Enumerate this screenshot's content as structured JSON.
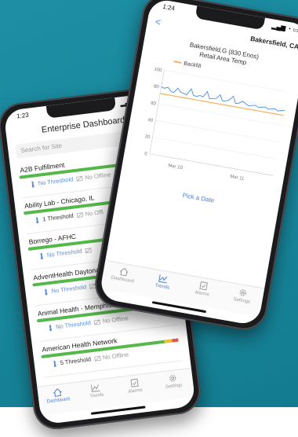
{
  "left_phone": {
    "time": "1:23",
    "title": "Enterprise Dashboard",
    "search_placeholder": "Search for Site",
    "sites": [
      {
        "name": "A2B Fulfillment",
        "threshold": "No Threshold",
        "offline": "No Offline",
        "bar": "green"
      },
      {
        "name": "Ability Lab - Chicago, IL",
        "threshold": "1 Threshold",
        "offline": "No Offl",
        "bar": "green-yellow"
      },
      {
        "name": "Borrego - AFHC",
        "threshold": "No Threshold",
        "offline": "",
        "bar": "green"
      },
      {
        "name": "AdventHealth Daytona",
        "threshold": "No Threshold",
        "offline": "",
        "bar": "green"
      },
      {
        "name": "Animal Health - Memphis",
        "threshold": "No Threshold",
        "offline": "No Offline",
        "bar": "green"
      },
      {
        "name": "American Health Network",
        "threshold": "5 Threshold",
        "offline": "No Offline",
        "bar": "green-yellow-red"
      }
    ],
    "tabs": [
      {
        "label": "Dashboard",
        "icon": "home-icon",
        "active": true
      },
      {
        "label": "Trends",
        "icon": "trend-icon",
        "active": false
      },
      {
        "label": "Alarms",
        "icon": "alarm-icon",
        "active": false
      },
      {
        "label": "Settings",
        "icon": "gear-icon",
        "active": false
      }
    ]
  },
  "right_phone": {
    "time": "1:24",
    "nav_back": "<",
    "nav_title": "Bakersfield, CA",
    "chart_title_line1": "Bakersfield,G (830 Enos)",
    "chart_title_line2": "Retail Area Temp",
    "legend_label": "Backfill",
    "pick_date": "Pick a Date",
    "tabs": [
      {
        "label": "Dashboard",
        "icon": "home-icon",
        "active": false
      },
      {
        "label": "Trends",
        "icon": "trend-icon",
        "active": true
      },
      {
        "label": "Alarms",
        "icon": "alarm-icon",
        "active": false
      },
      {
        "label": "Settings",
        "icon": "gear-icon",
        "active": false
      }
    ]
  },
  "chart_data": {
    "type": "line",
    "title": "Bakersfield,G (830 Enos) Retail Area Temp",
    "ylim": [
      0,
      100
    ],
    "yticks": [
      0,
      20,
      40,
      60,
      80,
      100
    ],
    "xticks": [
      "Mar 10",
      "Mar 11"
    ],
    "series": [
      {
        "name": "",
        "color": "#4a90e2",
        "values": [
          80,
          79,
          81,
          77,
          76,
          82,
          78,
          77,
          76,
          84,
          77,
          76,
          78,
          77,
          84,
          76,
          77,
          78,
          83,
          76,
          77,
          79,
          84,
          76,
          77,
          80,
          78,
          76,
          77,
          78,
          76,
          77,
          78,
          76,
          77,
          78,
          76,
          77,
          78
        ]
      },
      {
        "name": "Backfill",
        "color": "#f2b15f",
        "values": [
          72,
          72,
          72,
          72,
          72,
          72,
          72,
          72,
          72,
          72,
          72,
          72,
          72,
          72,
          72,
          72,
          72,
          72,
          72,
          72,
          72,
          72,
          72,
          72,
          72,
          72,
          72,
          72,
          72,
          72,
          72,
          72,
          72,
          72,
          72,
          72,
          72,
          72,
          72
        ]
      }
    ]
  },
  "colors": {
    "accent": "#4a7fd6",
    "ok": "#55b84a",
    "warn": "#f1c232",
    "alarm": "#e25a4a"
  }
}
